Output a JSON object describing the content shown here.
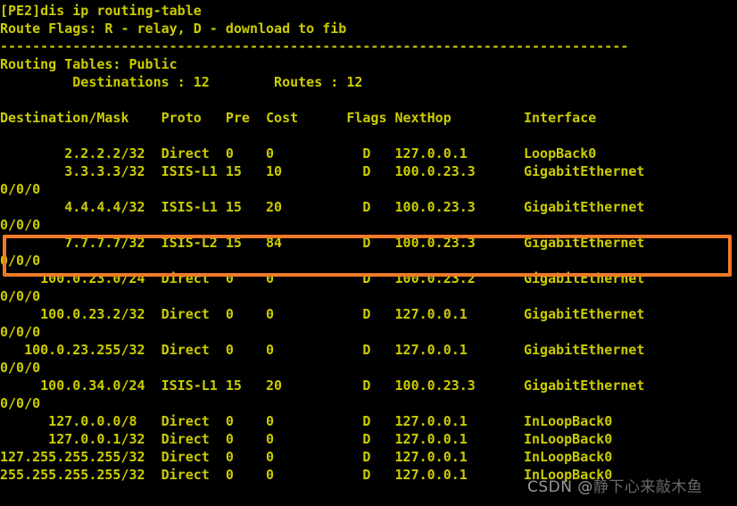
{
  "terminal": {
    "prompt_line": "[PE2]dis ip routing-table",
    "background_color": "#000000",
    "text_color": "#cccc00",
    "highlight_border_color": "#ef7a28",
    "lines": [
      "[PE2]dis ip routing-table",
      "Route Flags: R - relay, D - download to fib",
      "------------------------------------------------------------------------------",
      "Routing Tables: Public",
      "         Destinations : 12        Routes : 12",
      "",
      "Destination/Mask    Proto   Pre  Cost      Flags NextHop         Interface",
      "",
      "        2.2.2.2/32  Direct  0    0           D   127.0.0.1       LoopBack0",
      "        3.3.3.3/32  ISIS-L1 15   10          D   100.0.23.3      GigabitEthernet",
      "0/0/0",
      "        4.4.4.4/32  ISIS-L1 15   20          D   100.0.23.3      GigabitEthernet",
      "0/0/0",
      "        7.7.7.7/32  ISIS-L2 15   84          D   100.0.23.3      GigabitEthernet",
      "0/0/0",
      "     100.0.23.0/24  Direct  0    0           D   100.0.23.2      GigabitEthernet",
      "0/0/0",
      "     100.0.23.2/32  Direct  0    0           D   127.0.0.1       GigabitEthernet",
      "0/0/0",
      "   100.0.23.255/32  Direct  0    0           D   127.0.0.1       GigabitEthernet",
      "0/0/0",
      "     100.0.34.0/24  ISIS-L1 15   20          D   100.0.23.3      GigabitEthernet",
      "0/0/0",
      "      127.0.0.0/8   Direct  0    0           D   127.0.0.1       InLoopBack0",
      "      127.0.0.1/32  Direct  0    0           D   127.0.0.1       InLoopBack0",
      "127.255.255.255/32  Direct  0    0           D   127.0.0.1       InLoopBack0",
      "255.255.255.255/32  Direct  0    0           D   127.0.0.1       InLoopBack0"
    ],
    "header_info": {
      "route_flags": "Route Flags: R - relay, D - download to fib",
      "routing_tables": "Routing Tables: Public",
      "destinations_label": "Destinations",
      "destinations_count": "12",
      "routes_label": "Routes",
      "routes_count": "12"
    },
    "columns": [
      "Destination/Mask",
      "Proto",
      "Pre",
      "Cost",
      "Flags",
      "NextHop",
      "Interface"
    ],
    "routes": [
      {
        "destination": "2.2.2.2/32",
        "proto": "Direct",
        "pre": "0",
        "cost": "0",
        "flags": "D",
        "nexthop": "127.0.0.1",
        "interface": "LoopBack0",
        "highlighted": false
      },
      {
        "destination": "3.3.3.3/32",
        "proto": "ISIS-L1",
        "pre": "15",
        "cost": "10",
        "flags": "D",
        "nexthop": "100.0.23.3",
        "interface": "GigabitEthernet0/0/0",
        "highlighted": false
      },
      {
        "destination": "4.4.4.4/32",
        "proto": "ISIS-L1",
        "pre": "15",
        "cost": "20",
        "flags": "D",
        "nexthop": "100.0.23.3",
        "interface": "GigabitEthernet0/0/0",
        "highlighted": false
      },
      {
        "destination": "7.7.7.7/32",
        "proto": "ISIS-L2",
        "pre": "15",
        "cost": "84",
        "flags": "D",
        "nexthop": "100.0.23.3",
        "interface": "GigabitEthernet0/0/0",
        "highlighted": true
      },
      {
        "destination": "100.0.23.0/24",
        "proto": "Direct",
        "pre": "0",
        "cost": "0",
        "flags": "D",
        "nexthop": "100.0.23.2",
        "interface": "GigabitEthernet0/0/0",
        "highlighted": false
      },
      {
        "destination": "100.0.23.2/32",
        "proto": "Direct",
        "pre": "0",
        "cost": "0",
        "flags": "D",
        "nexthop": "127.0.0.1",
        "interface": "GigabitEthernet0/0/0",
        "highlighted": false
      },
      {
        "destination": "100.0.23.255/32",
        "proto": "Direct",
        "pre": "0",
        "cost": "0",
        "flags": "D",
        "nexthop": "127.0.0.1",
        "interface": "GigabitEthernet0/0/0",
        "highlighted": false
      },
      {
        "destination": "100.0.34.0/24",
        "proto": "ISIS-L1",
        "pre": "15",
        "cost": "20",
        "flags": "D",
        "nexthop": "100.0.23.3",
        "interface": "GigabitEthernet0/0/0",
        "highlighted": false
      },
      {
        "destination": "127.0.0.0/8",
        "proto": "Direct",
        "pre": "0",
        "cost": "0",
        "flags": "D",
        "nexthop": "127.0.0.1",
        "interface": "InLoopBack0",
        "highlighted": false
      },
      {
        "destination": "127.0.0.1/32",
        "proto": "Direct",
        "pre": "0",
        "cost": "0",
        "flags": "D",
        "nexthop": "127.0.0.1",
        "interface": "InLoopBack0",
        "highlighted": false
      },
      {
        "destination": "127.255.255.255/32",
        "proto": "Direct",
        "pre": "0",
        "cost": "0",
        "flags": "D",
        "nexthop": "127.0.0.1",
        "interface": "InLoopBack0",
        "highlighted": false
      },
      {
        "destination": "255.255.255.255/32",
        "proto": "Direct",
        "pre": "0",
        "cost": "0",
        "flags": "D",
        "nexthop": "127.0.0.1",
        "interface": "InLoopBack0",
        "highlighted": false
      }
    ]
  },
  "watermark": {
    "prefix": "CSDN @",
    "handle": "静下心来敲木鱼"
  }
}
